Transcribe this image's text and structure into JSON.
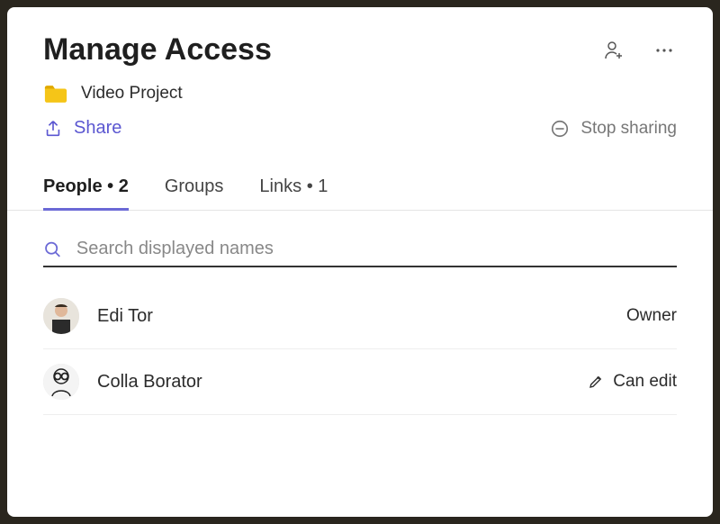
{
  "header": {
    "title": "Manage Access",
    "add_user_label": "Add user",
    "more_label": "More options"
  },
  "item": {
    "folder_name": "Video Project"
  },
  "actions": {
    "share_label": "Share",
    "stop_sharing_label": "Stop sharing"
  },
  "tabs": {
    "people_label": "People",
    "people_count": "2",
    "groups_label": "Groups",
    "links_label": "Links",
    "links_count": "1"
  },
  "search": {
    "placeholder": "Search displayed names"
  },
  "people": [
    {
      "name": "Edi Tor",
      "role": "Owner",
      "editable": false
    },
    {
      "name": "Colla Borator",
      "role": "Can edit",
      "editable": true
    }
  ]
}
